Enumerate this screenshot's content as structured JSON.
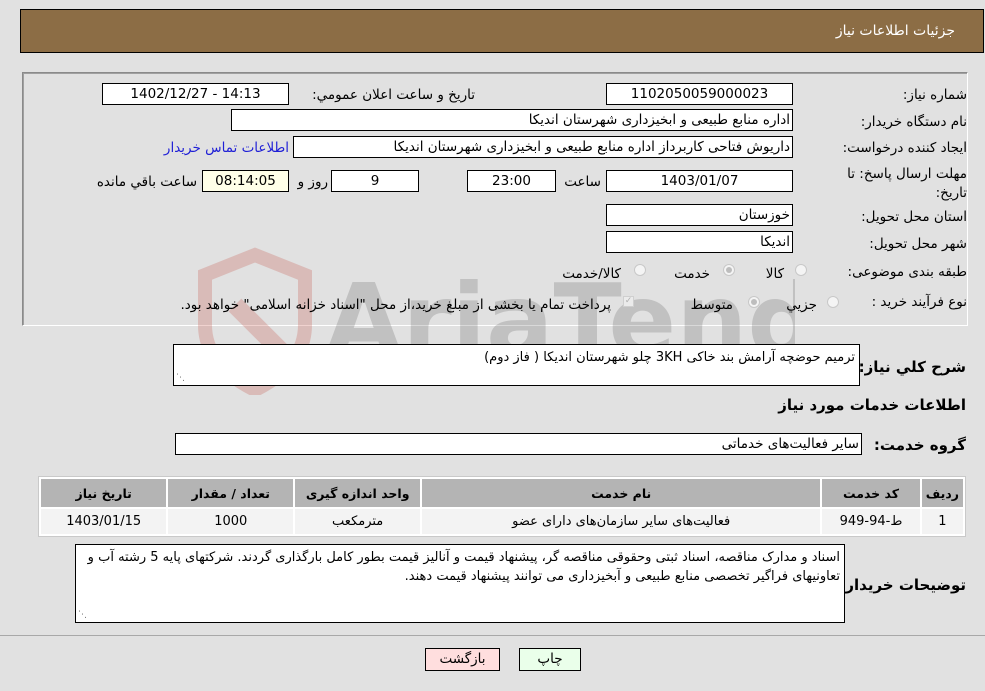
{
  "header": {
    "title": "جزئیات اطلاعات نیاز"
  },
  "form": {
    "need_number": {
      "label": "شماره نیاز:",
      "value": "1102050059000023"
    },
    "announce_datetime": {
      "label": "تاریخ و ساعت اعلان عمومي:",
      "value": "1402/12/27 - 14:13"
    },
    "buyer_org": {
      "label": "نام دستگاه خریدار:",
      "value": "اداره منابع طبیعی و ابخیزداری شهرستان اندیکا"
    },
    "requester": {
      "label": "ایجاد کننده درخواست:",
      "value": "داریوش فتاحی کاربرداز اداره منابع طبیعی و ابخیزداری شهرستان اندیکا"
    },
    "buyer_contact_link": "اطلاعات تماس خریدار",
    "deadline": {
      "label": "مهلت ارسال پاسخ: تا تاریخ:",
      "date": "1403/01/07",
      "time_label": "ساعت",
      "time": "23:00",
      "days": "9",
      "days_label": "روز و",
      "remaining": "08:14:05",
      "remaining_label": "ساعت باقي مانده"
    },
    "province": {
      "label": "استان محل تحویل:",
      "value": "خوزستان"
    },
    "city": {
      "label": "شهر محل تحویل:",
      "value": "اندیکا"
    },
    "category": {
      "label": "طبقه بندی موضوعی:",
      "options": [
        "کالا",
        "خدمت",
        "کالا/خدمت"
      ],
      "selected": "خدمت"
    },
    "purchase_type": {
      "label": "نوع فرآیند خرید :",
      "options": [
        "جزیي",
        "متوسط"
      ],
      "selected": "متوسط",
      "treasury_note": "پرداخت تمام یا بخشی از مبلغ خرید،از محل \"اسناد خزانه اسلامی\" خواهد بود."
    }
  },
  "description": {
    "label": "شرح کلي نیاز:",
    "value": "ترمیم حوضچه آرامش بند خاکی 3KH  چلو شهرستان اندیکا ( فاز دوم)"
  },
  "services_section": {
    "title": "اطلاعات خدمات مورد نیاز",
    "group_label": "گروه خدمت:",
    "group_value": "سایر فعالیت‌های خدماتی",
    "table": {
      "headers": [
        "ردیف",
        "کد خدمت",
        "نام خدمت",
        "واحد اندازه گیری",
        "تعداد / مقدار",
        "تاریخ نیاز"
      ],
      "rows": [
        [
          "1",
          "ط-94-949",
          "فعالیت‌های سایر سازمان‌های دارای عضو",
          "مترمکعب",
          "1000",
          "1403/01/15"
        ]
      ]
    }
  },
  "buyer_notes": {
    "label": "توضیحات خریدار:",
    "value": "اسناد و مدارک مناقصه، اسناد ثبتی وحقوقی مناقصه گر، پیشنهاد قیمت و آنالیز قیمت بطور کامل بارگذاری گردند. شرکتهای پایه 5 رشته آب و تعاونیهای فراگیر تخصصی منابع طبیعی و آبخیزداری می توانند پیشنهاد قیمت دهند."
  },
  "buttons": {
    "print": "چاپ",
    "back": "بازگشت"
  },
  "colors": {
    "header_bg": "#8c6d45",
    "print_bg": "#eaffea",
    "back_bg": "#ffdede",
    "link": "#1f1fd6"
  }
}
